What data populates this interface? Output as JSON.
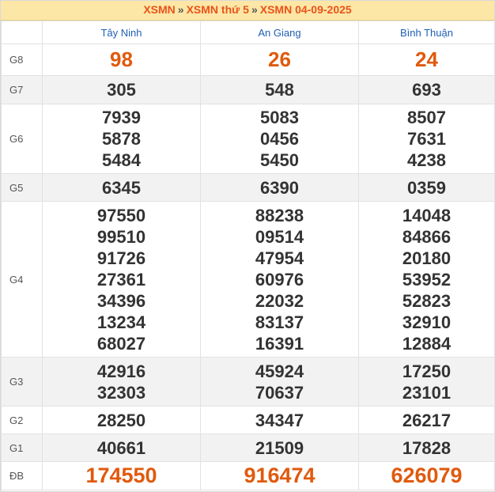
{
  "header": {
    "crumb1": "XSMN",
    "crumb2": "XSMN thứ 5",
    "crumb3": "XSMN 04-09-2025",
    "separator": "»"
  },
  "provinces": [
    "Tây Ninh",
    "An Giang",
    "Bình Thuận"
  ],
  "prizes": [
    {
      "label": "G8",
      "values": [
        [
          "98"
        ],
        [
          "26"
        ],
        [
          "24"
        ]
      ]
    },
    {
      "label": "G7",
      "values": [
        [
          "305"
        ],
        [
          "548"
        ],
        [
          "693"
        ]
      ]
    },
    {
      "label": "G6",
      "values": [
        [
          "7939",
          "5878",
          "5484"
        ],
        [
          "5083",
          "0456",
          "5450"
        ],
        [
          "8507",
          "7631",
          "4238"
        ]
      ]
    },
    {
      "label": "G5",
      "values": [
        [
          "6345"
        ],
        [
          "6390"
        ],
        [
          "0359"
        ]
      ]
    },
    {
      "label": "G4",
      "values": [
        [
          "97550",
          "99510",
          "91726",
          "27361",
          "34396",
          "13234",
          "68027"
        ],
        [
          "88238",
          "09514",
          "47954",
          "60976",
          "22032",
          "83137",
          "16391"
        ],
        [
          "14048",
          "84866",
          "20180",
          "53952",
          "52823",
          "32910",
          "12884"
        ]
      ]
    },
    {
      "label": "G3",
      "values": [
        [
          "42916",
          "32303"
        ],
        [
          "45924",
          "70637"
        ],
        [
          "17250",
          "23101"
        ]
      ]
    },
    {
      "label": "G2",
      "values": [
        [
          "28250"
        ],
        [
          "34347"
        ],
        [
          "26217"
        ]
      ]
    },
    {
      "label": "G1",
      "values": [
        [
          "40661"
        ],
        [
          "21509"
        ],
        [
          "17828"
        ]
      ]
    },
    {
      "label": "ĐB",
      "values": [
        [
          "174550"
        ],
        [
          "916474"
        ],
        [
          "626079"
        ]
      ]
    }
  ]
}
